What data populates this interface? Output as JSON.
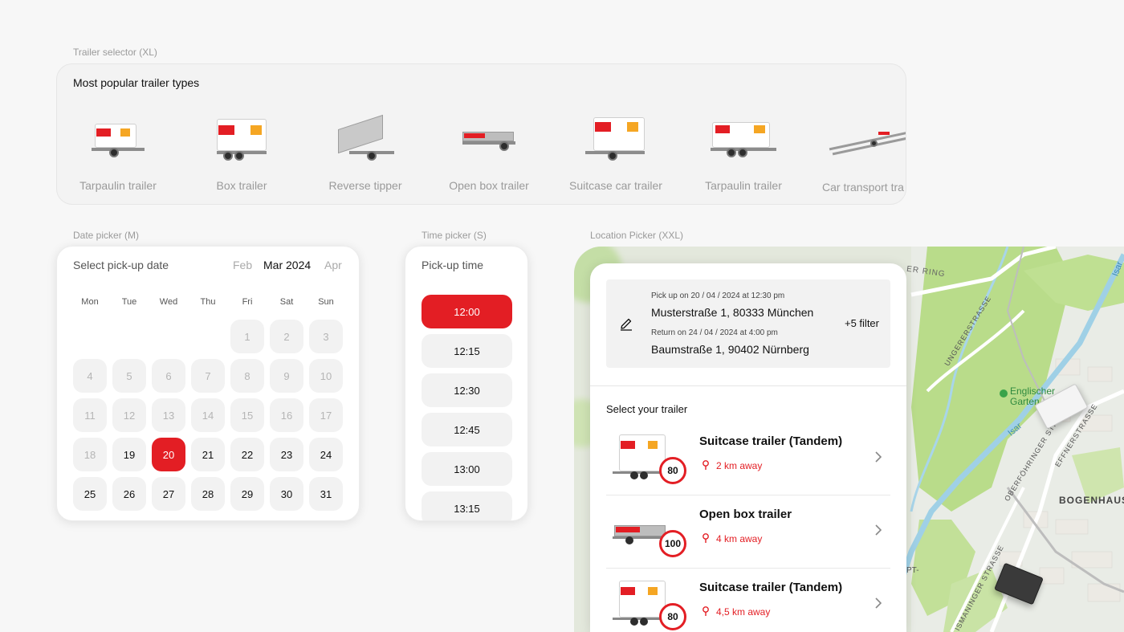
{
  "labels": {
    "trailer_selector": "Trailer selector (XL)",
    "date_picker": "Date picker (M)",
    "time_picker": "Time picker (S)",
    "location_picker": "Location Picker (XXL)"
  },
  "trailer_selector": {
    "title": "Most popular trailer types",
    "items": [
      {
        "label": "Tarpaulin trailer",
        "icon": "tarpaulin-trailer-image"
      },
      {
        "label": "Box trailer",
        "icon": "box-trailer-image"
      },
      {
        "label": "Reverse tipper",
        "icon": "reverse-tipper-image"
      },
      {
        "label": "Open box trailer",
        "icon": "open-box-trailer-image"
      },
      {
        "label": "Suitcase car trailer",
        "icon": "suitcase-car-trailer-image"
      },
      {
        "label": "Tarpaulin trailer",
        "icon": "tarpaulin-trailer-image"
      },
      {
        "label": "Car transport tra",
        "icon": "car-transport-trailer-image"
      }
    ]
  },
  "date_picker": {
    "title": "Select pick-up date",
    "months": {
      "prev": "Feb",
      "current": "Mar 2024",
      "next": "Apr"
    },
    "weekdays": [
      "Mon",
      "Tue",
      "Wed",
      "Thu",
      "Fri",
      "Sat",
      "Sun"
    ],
    "days": [
      {
        "label": "1",
        "state": "disabled"
      },
      {
        "label": "2",
        "state": "disabled"
      },
      {
        "label": "3",
        "state": "disabled"
      },
      {
        "label": "4",
        "state": "disabled"
      },
      {
        "label": "5",
        "state": "disabled"
      },
      {
        "label": "6",
        "state": "disabled"
      },
      {
        "label": "7",
        "state": "disabled"
      },
      {
        "label": "8",
        "state": "disabled"
      },
      {
        "label": "9",
        "state": "disabled"
      },
      {
        "label": "10",
        "state": "disabled"
      },
      {
        "label": "11",
        "state": "disabled"
      },
      {
        "label": "12",
        "state": "disabled"
      },
      {
        "label": "13",
        "state": "disabled"
      },
      {
        "label": "14",
        "state": "disabled"
      },
      {
        "label": "15",
        "state": "disabled"
      },
      {
        "label": "16",
        "state": "disabled"
      },
      {
        "label": "17",
        "state": "disabled"
      },
      {
        "label": "18",
        "state": "disabled"
      },
      {
        "label": "19",
        "state": "available"
      },
      {
        "label": "20",
        "state": "selected"
      },
      {
        "label": "21",
        "state": "available"
      },
      {
        "label": "22",
        "state": "available"
      },
      {
        "label": "23",
        "state": "available"
      },
      {
        "label": "24",
        "state": "available"
      },
      {
        "label": "25",
        "state": "available"
      },
      {
        "label": "26",
        "state": "available"
      },
      {
        "label": "27",
        "state": "available"
      },
      {
        "label": "28",
        "state": "available"
      },
      {
        "label": "29",
        "state": "available"
      },
      {
        "label": "30",
        "state": "available"
      },
      {
        "label": "31",
        "state": "available"
      }
    ]
  },
  "time_picker": {
    "title": "Pick-up time",
    "slots": [
      {
        "label": "12:00",
        "state": "selected"
      },
      {
        "label": "12:15",
        "state": "available"
      },
      {
        "label": "12:30",
        "state": "available"
      },
      {
        "label": "12:45",
        "state": "available"
      },
      {
        "label": "13:00",
        "state": "available"
      },
      {
        "label": "13:15",
        "state": "available"
      }
    ]
  },
  "location_picker": {
    "pickup_info": "Pick up on 20 / 04 / 2024 at 12:30 pm",
    "pickup_address": "Musterstraße 1, 80333 München",
    "return_info": "Return on 24 / 04 / 2024 at 4:00 pm",
    "return_address": "Baumstraße 1, 90402 Nürnberg",
    "filter": "+5 filter",
    "select_title": "Select your trailer",
    "results": [
      {
        "name": "Suitcase trailer  (Tandem)",
        "distance": "2 km away",
        "speed": "80"
      },
      {
        "name": "Open box trailer",
        "distance": "4 km away",
        "speed": "100"
      },
      {
        "name": "Suitcase trailer  (Tandem)",
        "distance": "4,5 km away",
        "speed": "80"
      }
    ],
    "map_labels": {
      "ring": "ER RING",
      "isar_top": "Isar",
      "ungerer": "UNGERERSTRASSE",
      "garden": "Englischer Garten",
      "isar_mid": "Isar",
      "oberfoehringer": "OBERFÖHRINGER STR.",
      "effner": "EFFNERSTRASSE",
      "bogenhausen": "BOGENHAUS",
      "ismaninger": "ISMANINGER STRASSE",
      "pt": "PT-"
    }
  },
  "colors": {
    "accent": "#e31e24",
    "map_green": "#b9dc8a",
    "map_water": "#9fd0e6"
  }
}
